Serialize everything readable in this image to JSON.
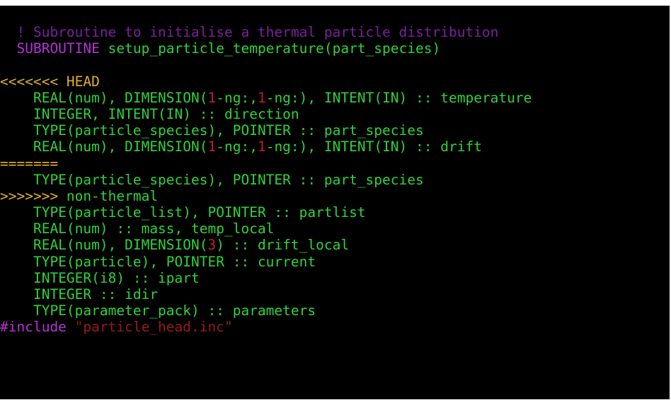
{
  "editor": {
    "lines": [
      [
        {
          "t": "  ! Subroutine to initialise a thermal particle distribution",
          "c": "comment"
        }
      ],
      [
        {
          "t": "  SUBROUTINE",
          "c": "keyword"
        },
        {
          "t": " setup_particle_temperature(part_species)",
          "c": "green"
        }
      ],
      [
        {
          "t": "",
          "c": "green"
        }
      ],
      [
        {
          "t": "<<<<<<< HEAD",
          "c": "yellow"
        }
      ],
      [
        {
          "t": "    REAL(num), DIMENSION(",
          "c": "green"
        },
        {
          "t": "1",
          "c": "red"
        },
        {
          "t": "-ng:,",
          "c": "green"
        },
        {
          "t": "1",
          "c": "red"
        },
        {
          "t": "-ng:), INTENT(IN) :: temperature",
          "c": "green"
        }
      ],
      [
        {
          "t": "    INTEGER, INTENT(IN) :: direction",
          "c": "green"
        }
      ],
      [
        {
          "t": "    TYPE(particle_species), POINTER :: part_species",
          "c": "green"
        }
      ],
      [
        {
          "t": "    REAL(num), DIMENSION(",
          "c": "green"
        },
        {
          "t": "1",
          "c": "red"
        },
        {
          "t": "-ng:,",
          "c": "green"
        },
        {
          "t": "1",
          "c": "red"
        },
        {
          "t": "-ng:), INTENT(IN) :: drift",
          "c": "green"
        }
      ],
      [
        {
          "t": "=======",
          "c": "yellow"
        }
      ],
      [
        {
          "t": "    TYPE(particle_species), POINTER :: part_species",
          "c": "green"
        }
      ],
      [
        {
          "t": ">>>>>>>",
          "c": "yellow"
        },
        {
          "t": " non-thermal",
          "c": "green"
        }
      ],
      [
        {
          "t": "    TYPE(particle_list), POINTER :: partlist",
          "c": "green"
        }
      ],
      [
        {
          "t": "    REAL(num) :: mass, temp_local",
          "c": "green"
        }
      ],
      [
        {
          "t": "    REAL(num), DIMENSION(",
          "c": "green"
        },
        {
          "t": "3",
          "c": "red"
        },
        {
          "t": ") :: drift_local",
          "c": "green"
        }
      ],
      [
        {
          "t": "    TYPE(particle), POINTER :: current",
          "c": "green"
        }
      ],
      [
        {
          "t": "    INTEGER(i8) :: ipart",
          "c": "green"
        }
      ],
      [
        {
          "t": "    INTEGER :: idir",
          "c": "green"
        }
      ],
      [
        {
          "t": "    TYPE(parameter_pack) :: parameters",
          "c": "green"
        }
      ],
      [
        {
          "t": "#include",
          "c": "inc-magenta"
        },
        {
          "t": " \"particle_head.inc\"",
          "c": "string-red"
        }
      ]
    ]
  }
}
